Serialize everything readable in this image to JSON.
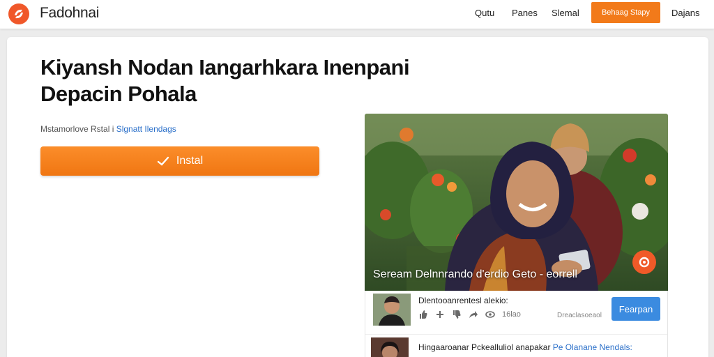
{
  "header": {
    "brand": "Fadohnai",
    "nav": [
      "Qutu",
      "Panes",
      "Slemal"
    ],
    "cta_label": "Behaag Stapy",
    "last_link": "Dajans",
    "accent_color": "#f27a1a"
  },
  "hero": {
    "title": "Kiyansh Nodan Iangarhkara Inenpani Depacin Pohala",
    "subtitle_prefix": "Mstamorlove Rstal i",
    "subtitle_link": "Slgnatt Ilendags",
    "install_icon": "check-icon",
    "install_label": "Instal"
  },
  "media": {
    "caption": "Seream Delnnrando d'erdio Geto - eorrell",
    "record_icon": "record-icon"
  },
  "feed": {
    "items": [
      {
        "title": "Dlentooanrentesl alekio:",
        "likes": "",
        "views": "16lao",
        "user": "Dreaclasoeaol",
        "follow_label": "Fearpan"
      },
      {
        "title_prefix": "Hingaaroanar Pckealluliol anapakar",
        "title_link": "Pe Olanane Nendals:"
      }
    ]
  }
}
